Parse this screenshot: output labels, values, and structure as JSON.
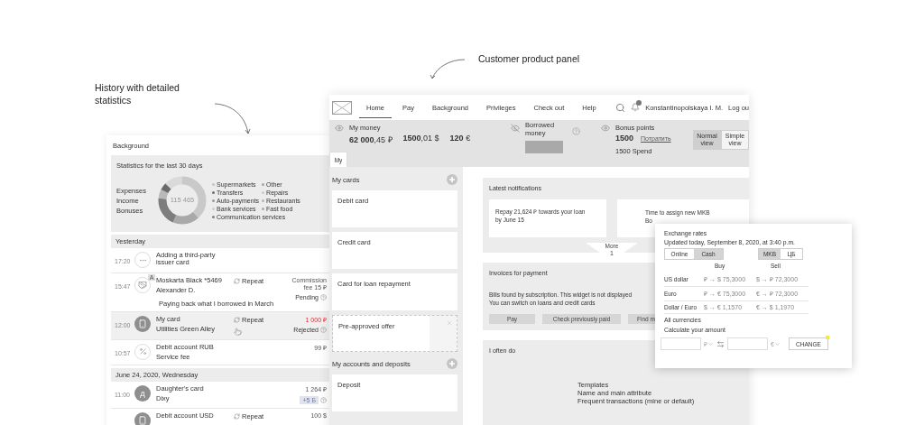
{
  "annotations": [
    {
      "text": "History with detailed statistics"
    },
    {
      "text": "Customer product panel"
    }
  ],
  "history": {
    "title": "Background",
    "stats": {
      "title": "Statistics for the last 30 days",
      "labels": [
        "Expenses",
        "Income",
        "Bonuses"
      ],
      "total": "115 465",
      "legend": [
        {
          "label": "Supermarkets",
          "color": "#c4c4c4"
        },
        {
          "label": "Other",
          "color": "#a6a6a6"
        },
        {
          "label": "Transfers",
          "color": "#6e6e6e"
        },
        {
          "label": "Repairs",
          "color": "#c8c8c8"
        },
        {
          "label": "Auto-payments",
          "color": "#9a9a9a"
        },
        {
          "label": "Restaurants",
          "color": "#b4b4b4"
        },
        {
          "label": "Bank services",
          "color": "#cbcbcb"
        },
        {
          "label": "Fast food",
          "color": "#aaaaaa"
        },
        {
          "label": "Communication services",
          "color": "#808080"
        }
      ]
    },
    "sections": [
      {
        "title": "Yesterday",
        "rows": [
          {
            "time": "17:20",
            "kind": "dots",
            "title": "Adding a third-party issuer card",
            "amount": [],
            "help": false,
            "selected": false,
            "pointer": false
          },
          {
            "time": "15:47",
            "kind": "handshake",
            "badge": "A",
            "title": "Moskarta Black *5469",
            "subtitle": "Alexander D.",
            "note": "Paying back what I borrowed in March",
            "repeat": "Repeat",
            "amount": [
              "Commission fee 15 ₽"
            ],
            "status": "Pending",
            "help": true,
            "selected": false,
            "failed": false,
            "pointer": false
          },
          {
            "time": "12:00",
            "kind": "phone",
            "title": "My card",
            "subtitle": "Utilities Green Alley",
            "repeat": "Repeat",
            "amount": [
              "1 000 ₽"
            ],
            "status": "Rejected",
            "help": true,
            "selected": true,
            "failed": true,
            "pointer": true
          },
          {
            "time": "10:57",
            "kind": "percent",
            "title": "Debit account RUB",
            "subtitle": "Service fee",
            "amount": [
              "99 ₽"
            ],
            "help": false,
            "selected": false,
            "failed": false,
            "pointer": false
          }
        ]
      },
      {
        "title": "June 24, 2020, Wednesday",
        "rows": [
          {
            "time": "11:00",
            "kind": "letter",
            "avatar": "Д",
            "title": "Daughter's card",
            "subtitle": "Dixy",
            "amount": [
              "1 264 ₽"
            ],
            "bonus": "+5 Б",
            "help": true,
            "selected": false,
            "failed": false,
            "pointer": false
          },
          {
            "kind": "phone",
            "title": "Debit account USD",
            "repeat": "Repeat",
            "amount": [
              "100 $"
            ],
            "help": false,
            "selected": false,
            "failed": false,
            "pointer": false
          }
        ]
      }
    ]
  },
  "panel": {
    "nav": [
      {
        "label": "Home",
        "selected": true
      },
      {
        "label": "Pay",
        "selected": false
      },
      {
        "label": "Background",
        "selected": false
      },
      {
        "label": "Privileges",
        "selected": false
      },
      {
        "label": "Check out",
        "selected": false
      },
      {
        "label": "Help",
        "selected": false
      }
    ],
    "user": "Konstantinopolskaya I. M.",
    "logout": "Log ou",
    "money": {
      "label": "My money",
      "values": [
        "**62 000**,45 ₽",
        "**1500**,01 $",
        "**120** €"
      ]
    },
    "borrowed": {
      "label": "Borrowed money"
    },
    "bonus": {
      "label": "Bonus points",
      "value": "1500",
      "link": "Потратить",
      "spend": "1500 Spend"
    },
    "views": [
      {
        "label": "Normal view",
        "selected": true
      },
      {
        "label": "Simple view",
        "selected": false
      }
    ],
    "tab": "My",
    "cards": {
      "title": "My cards",
      "items": [
        {
          "label": "Debit card",
          "kind": "card"
        },
        {
          "label": "Credit card",
          "kind": "card"
        },
        {
          "label": "Card for loan repayment",
          "kind": "card"
        },
        {
          "label": "Pre-approved offer",
          "kind": "offer"
        }
      ]
    },
    "accounts": {
      "title": "My accounts and deposits",
      "items": [
        {
          "label": "Deposit",
          "kind": "card"
        }
      ]
    },
    "notifications": {
      "title": "Latest notifications",
      "items": [
        {
          "lines": [
            "Repay 21,624 ₽ towards your loan",
            "by June 15"
          ]
        },
        {
          "lines": [
            "Time to assign new MKB",
            "Bo"
          ]
        }
      ],
      "more": {
        "label": "More",
        "count": "1"
      }
    },
    "invoices": {
      "title": "Invoices for payment",
      "text": [
        "Bills found by subscription. This widget is not displayed",
        "You can switch on loans and credit cards"
      ],
      "buttons": [
        "Pay",
        "Check previously paid",
        "Find m"
      ]
    },
    "often": {
      "title": "I often do",
      "lines": [
        "Templates",
        "Name and main attribute",
        "Frequent transactions (mine or default)"
      ]
    }
  },
  "exchange": {
    "title": "Exchange rates",
    "updated": "Updated today, September 8, 2020, at 3:40 p.m.",
    "modes": [
      {
        "label": "Online",
        "selected": false
      },
      {
        "label": "Cash",
        "selected": true
      }
    ],
    "sources": [
      {
        "label": "MKB",
        "selected": true
      },
      {
        "label": "ЦБ",
        "selected": false
      }
    ],
    "columns": [
      "Buy",
      "Sell"
    ],
    "rows": [
      {
        "name": "US dollar",
        "buy_pair": "₽ → $",
        "buy": "75,3000",
        "sell_pair": "$ → ₽",
        "sell": "72,3000"
      },
      {
        "name": "Euro",
        "buy_pair": "₽ → €",
        "buy": "75,3000",
        "sell_pair": "€ → ₽",
        "sell": "72,3000"
      },
      {
        "name": "Dollar / Euro",
        "buy_pair": "$ → €",
        "buy": "1,1570",
        "sell_pair": "€ → $",
        "sell": "1,1970"
      }
    ],
    "all": "All currencies",
    "calc": "Calculate your amount",
    "from": "₽",
    "to": "€",
    "button": "CHANGE"
  }
}
